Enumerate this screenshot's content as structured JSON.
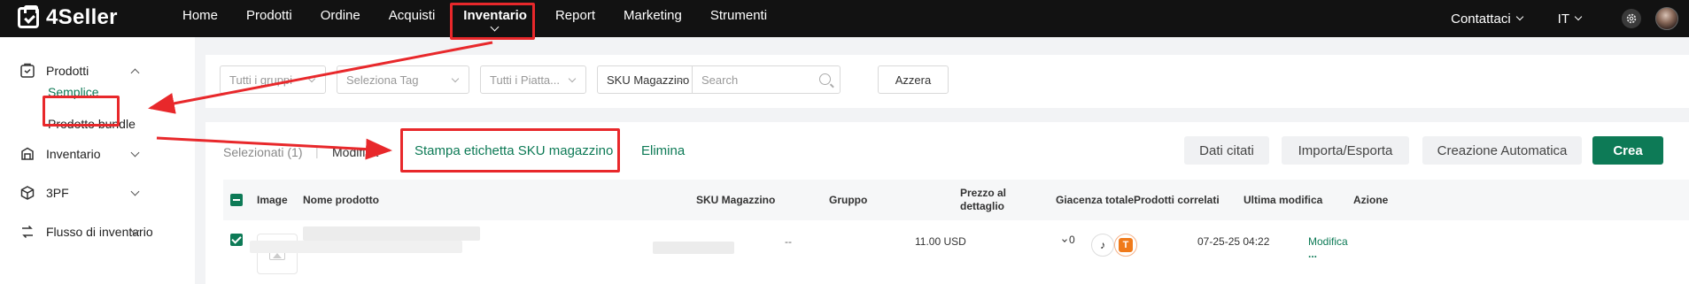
{
  "topbar": {
    "brand": "4Seller",
    "nav": [
      "Home",
      "Prodotti",
      "Ordine",
      "Acquisti",
      "Inventario",
      "Report",
      "Marketing",
      "Strumenti"
    ],
    "active_nav": "Inventario",
    "contact_label": "Contattaci",
    "language": "IT"
  },
  "sidebar": {
    "prodotti": "Prodotti",
    "semplice": "Semplice",
    "bundle": "Prodotto bundle",
    "inventario": "Inventario",
    "tpf": "3PF",
    "flusso": "Flusso di inventario"
  },
  "filters": {
    "gruppi_placeholder": "Tutti i gruppi",
    "tag_placeholder": "Seleziona Tag",
    "piattaforme_placeholder": "Tutti i Piatta...",
    "sku_select": "SKU Magazzino",
    "search_placeholder": "Search",
    "reset_label": "Azzera"
  },
  "toolbar": {
    "selected_label": "Selezionati (1)",
    "separator": "|",
    "modify_label": "Modifica",
    "print_label": "Stampa etichetta SKU magazzino",
    "delete_label": "Elimina",
    "dati_citati": "Dati citati",
    "import_export": "Importa/Esporta",
    "auto_create": "Creazione Automatica",
    "create": "Crea"
  },
  "table": {
    "headers": {
      "image": "Image",
      "name": "Nome prodotto",
      "sku": "SKU Magazzino",
      "group": "Gruppo",
      "price_line1": "Prezzo al",
      "price_line2": "dettaglio",
      "stock": "Giacenza totale",
      "related": "Prodotti correlati",
      "modified": "Ultima modifica",
      "action": "Azione"
    },
    "row": {
      "group": "--",
      "price": "11.00 USD",
      "stock": "0",
      "modified": "07-25-25 04:22",
      "action": "Modifica",
      "more": "..."
    }
  },
  "colors": {
    "accent": "#0d7a56",
    "topbar": "#121212",
    "annotation": "#e8282b"
  }
}
